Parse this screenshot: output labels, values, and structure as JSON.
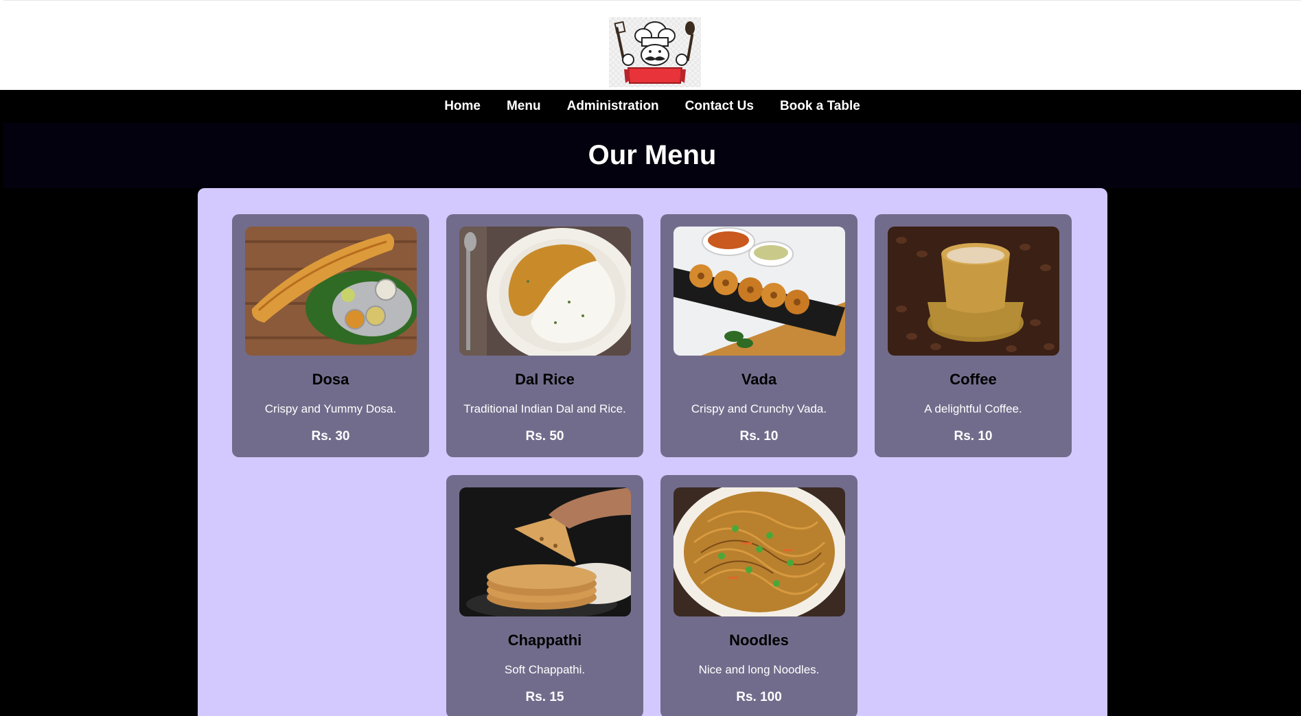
{
  "nav": {
    "items": [
      "Home",
      "Menu",
      "Administration",
      "Contact Us",
      "Book a Table"
    ]
  },
  "page": {
    "title": "Our Menu"
  },
  "colors": {
    "panel_bg": "#d3c9fe",
    "card_bg": "#726c8c",
    "page_bg": "#000000"
  },
  "menu": {
    "items": [
      {
        "name": "Dosa",
        "description": "Crispy and Yummy Dosa.",
        "price": "Rs. 30",
        "image": "dosa-image"
      },
      {
        "name": "Dal Rice",
        "description": "Traditional Indian Dal and Rice.",
        "price": "Rs. 50",
        "image": "dal-rice-image"
      },
      {
        "name": "Vada",
        "description": "Crispy and Crunchy Vada.",
        "price": "Rs. 10",
        "image": "vada-image"
      },
      {
        "name": "Coffee",
        "description": "A delightful Coffee.",
        "price": "Rs. 10",
        "image": "coffee-image"
      },
      {
        "name": "Chappathi",
        "description": "Soft Chappathi.",
        "price": "Rs. 15",
        "image": "chappathi-image"
      },
      {
        "name": "Noodles",
        "description": "Nice and long Noodles.",
        "price": "Rs. 100",
        "image": "noodles-image"
      }
    ]
  }
}
